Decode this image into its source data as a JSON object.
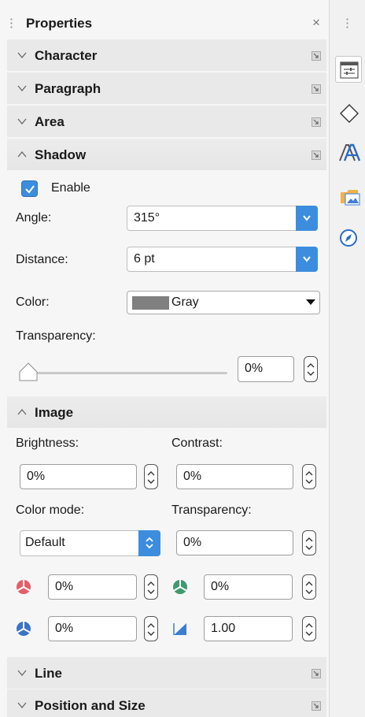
{
  "panel": {
    "title": "Properties",
    "close_glyph": "×"
  },
  "sections": {
    "character": "Character",
    "paragraph": "Paragraph",
    "area": "Area",
    "shadow": "Shadow",
    "image": "Image",
    "line": "Line",
    "position_size": "Position and Size"
  },
  "shadow": {
    "enable_label": "Enable",
    "enable_checked": true,
    "angle_label": "Angle:",
    "angle_value": "315°",
    "distance_label": "Distance:",
    "distance_value": "6 pt",
    "color_label": "Color:",
    "color_value": "Gray",
    "color_hex": "#808080",
    "transparency_label": "Transparency:",
    "transparency_value": "0%",
    "transparency_level": 0
  },
  "image": {
    "brightness_label": "Brightness:",
    "brightness_value": "0%",
    "contrast_label": "Contrast:",
    "contrast_value": "0%",
    "color_mode_label": "Color mode:",
    "color_mode_value": "Default",
    "transparency_label": "Transparency:",
    "transparency_value": "0%",
    "red_value": "0%",
    "green_value": "0%",
    "blue_value": "0%",
    "gamma_value": "1.00"
  },
  "rail": {
    "icons": [
      "properties-icon",
      "shapes-icon",
      "styles-icon",
      "gallery-icon",
      "navigator-icon"
    ]
  },
  "colors": {
    "accent": "#3c8ddd",
    "panel_bg": "#f6f6f6",
    "header_bg": "#e9e9e9"
  }
}
